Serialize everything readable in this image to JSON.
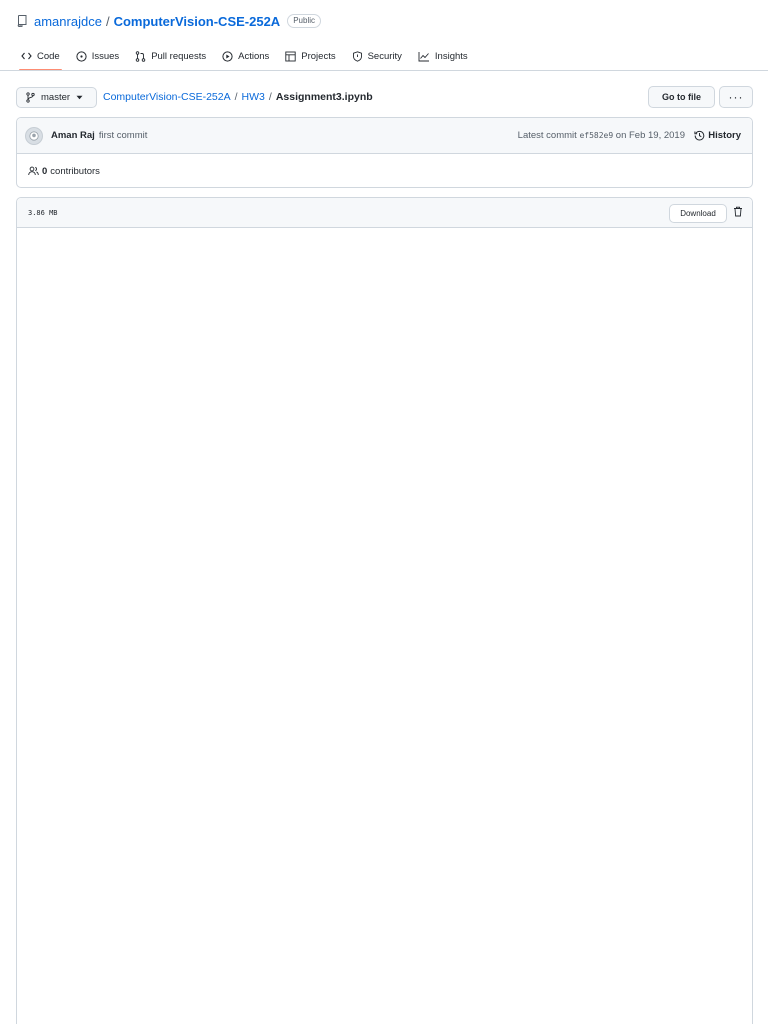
{
  "repo": {
    "owner": "amanrajdce",
    "separator": "/",
    "name": "ComputerVision-CSE-252A",
    "visibility": "Public"
  },
  "nav": {
    "tabs": [
      {
        "label": "Code",
        "icon": "code-icon"
      },
      {
        "label": "Issues",
        "icon": "issue-icon"
      },
      {
        "label": "Pull requests",
        "icon": "pull-request-icon"
      },
      {
        "label": "Actions",
        "icon": "play-icon"
      },
      {
        "label": "Projects",
        "icon": "table-icon"
      },
      {
        "label": "Security",
        "icon": "shield-icon"
      },
      {
        "label": "Insights",
        "icon": "graph-icon"
      }
    ],
    "selected": "Code"
  },
  "file_nav": {
    "branch": "master",
    "breadcrumb": {
      "repo": "ComputerVision-CSE-252A",
      "folder": "HW3",
      "file": "Assignment3.ipynb",
      "slash": "/"
    },
    "go_to_file": "Go to file",
    "more": "···"
  },
  "commit": {
    "author": "Aman Raj",
    "message": "first commit",
    "latest_label": "Latest commit",
    "sha": "ef582e9",
    "date": "on Feb 19, 2019",
    "history": "History"
  },
  "contributors": {
    "count": "0",
    "label": "contributors"
  },
  "file": {
    "size": "3.86 MB",
    "download": "Download"
  },
  "colors": {
    "link": "#0969da",
    "border": "#d0d7de",
    "tab_underline": "#fd8c73"
  }
}
